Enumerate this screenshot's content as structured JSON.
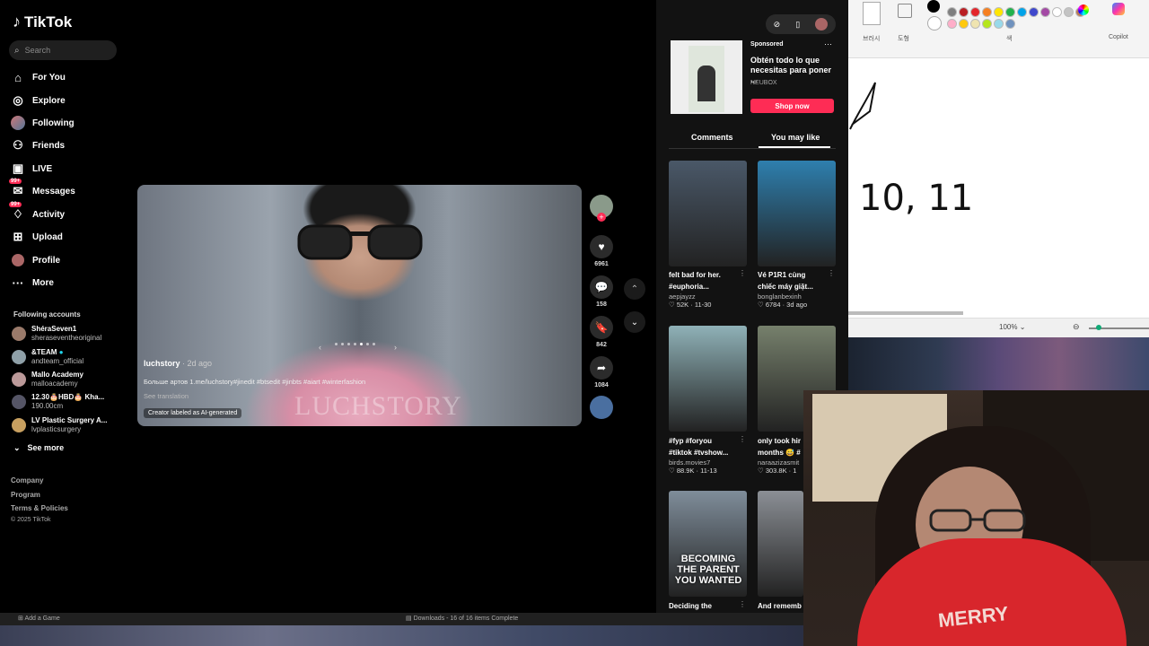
{
  "tiktok": {
    "logo": "TikTok",
    "search_placeholder": "Search",
    "nav": [
      {
        "label": "For You",
        "icon": "home-icon"
      },
      {
        "label": "Explore",
        "icon": "compass-icon"
      },
      {
        "label": "Following",
        "icon": "following-avatar-icon"
      },
      {
        "label": "Friends",
        "icon": "friends-icon"
      },
      {
        "label": "LIVE",
        "icon": "live-icon"
      },
      {
        "label": "Messages",
        "icon": "messages-icon",
        "badge": "99+"
      },
      {
        "label": "Activity",
        "icon": "activity-icon",
        "badge": "99+"
      },
      {
        "label": "Upload",
        "icon": "upload-icon"
      },
      {
        "label": "Profile",
        "icon": "profile-avatar-icon"
      },
      {
        "label": "More",
        "icon": "more-icon"
      }
    ],
    "following_title": "Following accounts",
    "accounts": [
      {
        "name": "ShéraSeven1",
        "user": "sheraseventheoriginal"
      },
      {
        "name": "&TEAM",
        "user": "andteam_official"
      },
      {
        "name": "Mallo Academy",
        "user": "malloacademy"
      },
      {
        "name": "12.30🎂HBD🎂 Kha...",
        "user": "190.00cm"
      },
      {
        "name": "LV Plastic Surgery A...",
        "user": "lvplasticsurgery"
      }
    ],
    "see_more": "See more",
    "footer": [
      "Company",
      "Program",
      "Terms & Policies",
      "© 2025 TikTok"
    ]
  },
  "video": {
    "author": "luchstory",
    "age": "· 2d ago",
    "description": "Больше артов 1.me/luchstory#jinedit #btsedit #jinbts #aiart #winterfashion",
    "see_translation": "See translation",
    "ai_label": "Creator labeled as AI-generated",
    "watermark": "LUCHSTORY",
    "likes": "6961",
    "comments": "158",
    "saves": "842",
    "shares": "1084"
  },
  "right": {
    "ad": {
      "sponsored": "Sponsored",
      "title": "Obtén todo lo que necesitas para poner ...",
      "brand": "NEUBOX",
      "cta": "Shop now"
    },
    "tabs": [
      "Comments",
      "You may like"
    ],
    "cards": [
      {
        "caption1": "felt bad for her.",
        "caption2": "#euphoria...",
        "user": "aepjayzz",
        "likes": "52K",
        "date": "11-30",
        "color": "#4a5868"
      },
      {
        "caption1": "Vé P1R1 cùng",
        "caption2": "chiếc máy giặt...",
        "user": "bonglanbexinh",
        "likes": "6784",
        "date": "3d ago",
        "color": "#2e7fae"
      },
      {
        "caption1": "#fyp #foryou",
        "caption2": "#tiktok #tvshow...",
        "user": "birds.movies7",
        "likes": "88.9K",
        "date": "11-13",
        "color": "#8fb1b7"
      },
      {
        "caption1": "only took hir",
        "caption2": "months 😅 #",
        "user": "naraazizasmit",
        "likes": "303.8K",
        "date": "1",
        "color": "#76806c"
      },
      {
        "caption1": "Deciding the",
        "caption2": "",
        "user": "",
        "likes": "",
        "date": "",
        "color": "#7f8d9a",
        "overlay": "BECOMING THE PARENT YOU WANTED"
      },
      {
        "caption1": "And rememb",
        "caption2": "",
        "user": "",
        "likes": "",
        "date": "",
        "color": "#8b8f95"
      }
    ]
  },
  "paint": {
    "labels": [
      "브러시",
      "도형",
      "색",
      "Copilot"
    ],
    "zoom": "100%",
    "handwriting": "10, 11"
  },
  "taskbar": {
    "game": "Add a Game",
    "downloads": "Downloads - 16 of 16 items Complete"
  },
  "webcam": {
    "shirt_text": "MERRY"
  },
  "colors": {
    "accent": "#fe2c55",
    "panel": "#121212"
  }
}
